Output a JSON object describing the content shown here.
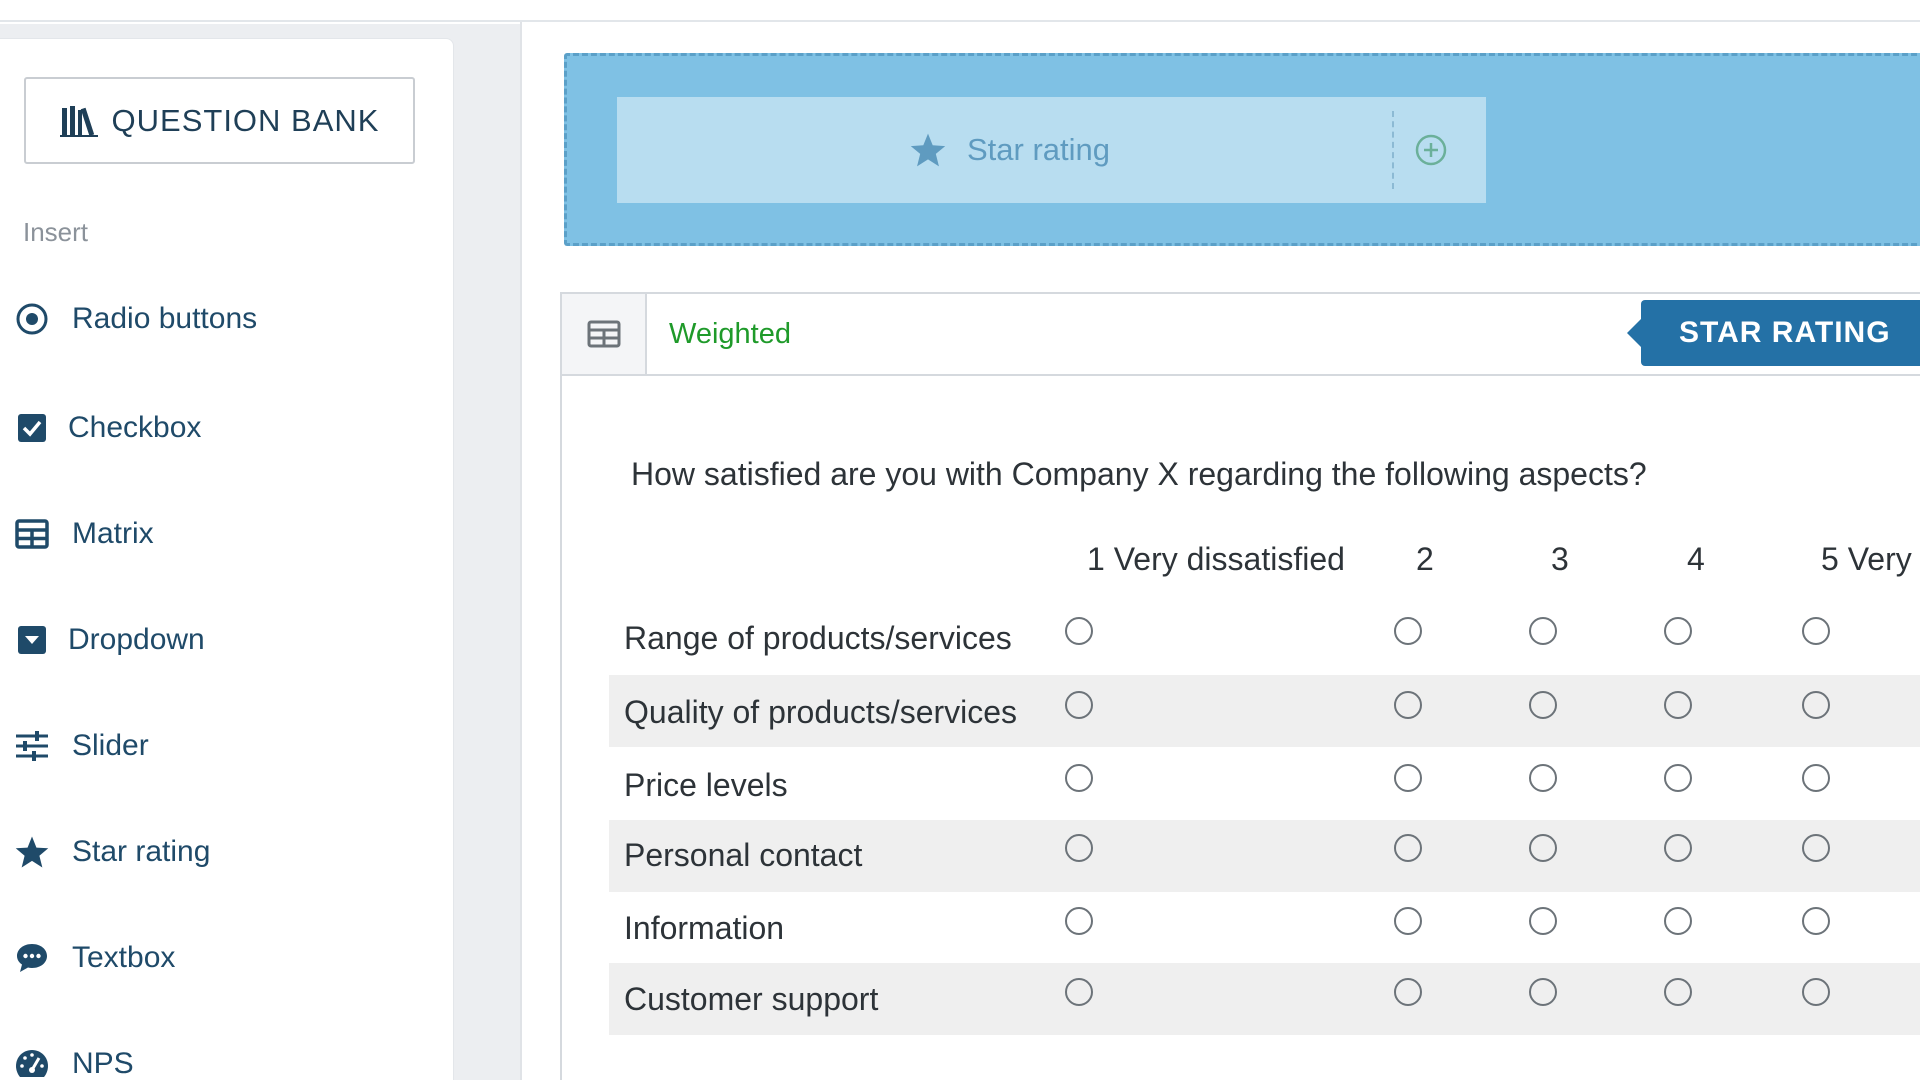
{
  "sidebar": {
    "question_bank_label": "QUESTION BANK",
    "insert_label": "Insert",
    "items": [
      {
        "label": "Radio buttons",
        "icon": "radio-icon"
      },
      {
        "label": "Checkbox",
        "icon": "checkbox-icon"
      },
      {
        "label": "Matrix",
        "icon": "matrix-icon"
      },
      {
        "label": "Dropdown",
        "icon": "dropdown-icon"
      },
      {
        "label": "Slider",
        "icon": "slider-icon"
      },
      {
        "label": "Star rating",
        "icon": "star-icon"
      },
      {
        "label": "Textbox",
        "icon": "chat-bubble-icon"
      },
      {
        "label": "NPS",
        "icon": "gauge-icon"
      }
    ]
  },
  "dropzone": {
    "card_label": "Star rating",
    "card_icon": "star-icon",
    "add_icon": "plus-circle-icon"
  },
  "question": {
    "header_badge": "Weighted",
    "type_tag": "STAR RATING",
    "text": "How satisfied are you with Company X regarding the following aspects?",
    "columns": [
      "1 Very dissatisfied",
      "2",
      "3",
      "4",
      "5 Very"
    ],
    "rows": [
      "Range of products/services",
      "Quality of products/services",
      "Price levels",
      "Personal contact",
      "Information",
      "Customer support"
    ]
  },
  "colors": {
    "accent": "#2471a6",
    "dropzone": "#7fc1e4",
    "weighted_green": "#1f9a2a",
    "sidebar_text": "#1f4a69"
  }
}
